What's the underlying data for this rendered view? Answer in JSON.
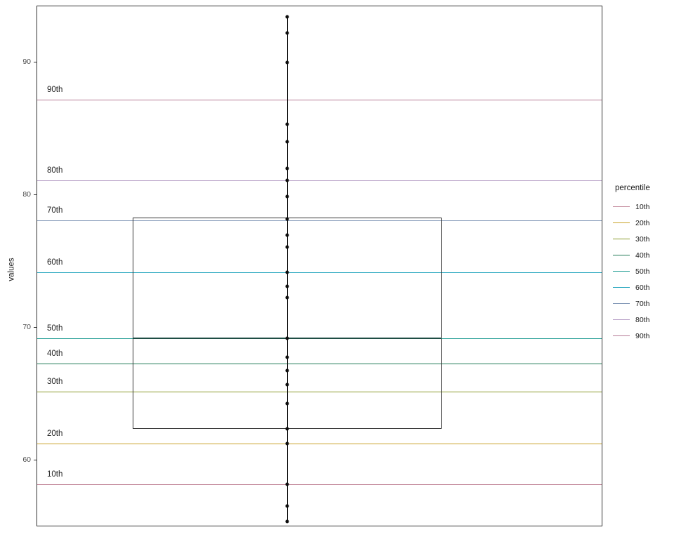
{
  "chart_data": {
    "type": "scatter",
    "title": "",
    "xlabel": "",
    "ylabel": "values",
    "ylim": [
      55.0,
      94.2
    ],
    "y_ticks": [
      60,
      70,
      80,
      90
    ],
    "y_tick_labels": [
      "60",
      "70",
      "80",
      "90"
    ],
    "grid": false,
    "legend": {
      "title": "percentile",
      "position": "right",
      "entries": [
        {
          "label": "10th",
          "color": "#c08497"
        },
        {
          "label": "20th",
          "color": "#c9a227"
        },
        {
          "label": "30th",
          "color": "#8a9a2b"
        },
        {
          "label": "40th",
          "color": "#1f7a55"
        },
        {
          "label": "50th",
          "color": "#2aa198"
        },
        {
          "label": "60th",
          "color": "#22a5bd"
        },
        {
          "label": "70th",
          "color": "#7f95b5"
        },
        {
          "label": "80th",
          "color": "#b49ac4"
        },
        {
          "label": "90th",
          "color": "#b57a95"
        }
      ]
    },
    "reference_lines": [
      {
        "label": "10th",
        "value": 58.2,
        "color": "#c08497",
        "annotation": "10th"
      },
      {
        "label": "20th",
        "value": 61.3,
        "color": "#c9a227",
        "annotation": "20th"
      },
      {
        "label": "30th",
        "value": 65.2,
        "color": "#8a9a2b",
        "annotation": "30th"
      },
      {
        "label": "40th",
        "value": 67.3,
        "color": "#1f7a55",
        "annotation": "40th"
      },
      {
        "label": "50th",
        "value": 69.2,
        "color": "#2aa198",
        "annotation": "50th"
      },
      {
        "label": "60th",
        "value": 74.2,
        "color": "#22a5bd",
        "annotation": "60th"
      },
      {
        "label": "70th",
        "value": 78.1,
        "color": "#7f95b5",
        "annotation": "70th"
      },
      {
        "label": "80th",
        "value": 81.1,
        "color": "#b49ac4",
        "annotation": "80th"
      },
      {
        "label": "90th",
        "value": 87.2,
        "color": "#b57a95",
        "annotation": "90th"
      }
    ],
    "boxplot": {
      "q1": 62.4,
      "median": 69.2,
      "q3": 78.3,
      "whisker_low": 55.4,
      "whisker_high": 93.4,
      "box_color": "#333333",
      "median_color": "#1e4d44"
    },
    "points": [
      93.4,
      92.2,
      90.0,
      85.3,
      84.0,
      82.0,
      81.1,
      79.9,
      78.2,
      77.0,
      76.1,
      74.2,
      73.1,
      72.3,
      69.2,
      67.8,
      66.8,
      65.7,
      64.3,
      62.4,
      61.3,
      58.2,
      56.6,
      55.4
    ]
  },
  "annotations": {
    "labels": [
      "10th",
      "20th",
      "30th",
      "40th",
      "50th",
      "60th",
      "70th",
      "80th",
      "90th"
    ]
  }
}
